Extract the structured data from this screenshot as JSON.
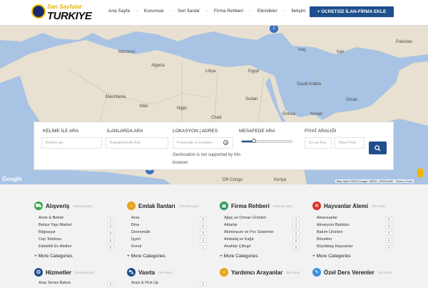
{
  "header": {
    "logo_top": "Sarı Sayfalar",
    "logo_main": "TURKIYE",
    "nav": [
      "Ana Sayfa",
      "Kurumsal",
      "Seri İlanlar",
      "Firma Rehberi",
      "Etkinlikler",
      "İletişim"
    ],
    "cta": "+ ÜCRETSİZ İLAN-FİRMA EKLE",
    "cta_color": "#1f4e8c"
  },
  "map": {
    "labels": [
      "Morocco",
      "Algeria",
      "Libya",
      "Egypt",
      "Iraq",
      "Iran",
      "Saudi Arabia",
      "Mauritania",
      "Mali",
      "Niger",
      "Chad",
      "Sudan",
      "Eritrea",
      "Yemen",
      "Oman",
      "DR Congo",
      "Kenya",
      "Pakistan"
    ],
    "cluster_top": "2",
    "cluster_bottom": "2",
    "attribution": "Map data ©2015 Google, INEGI, ORION-ME",
    "terms": "Terms of Use",
    "google": "Google"
  },
  "search": {
    "keyword_label": "KELİME İLE ARA",
    "keyword_placeholder": "Kelime gir",
    "category_label": "İLANLARDA ARA",
    "category_placeholder": "Kategorilerde Ara",
    "location_label": "LOKASYON | ADRES",
    "location_placeholder": "Postcode or location",
    "geo_note": "Geolocation is not supported by this browser.",
    "distance_label": "MESAFEDE ARA",
    "price_label": "FİYAT ARALIĞI",
    "price_min_placeholder": "En az fiya",
    "price_max_placeholder": "Max Price"
  },
  "categories": [
    {
      "title": "Alışveriş",
      "sub": "(Tümünü gör)",
      "color": "#3aa54a",
      "icon": "shopping-icon",
      "items": [
        {
          "name": "Anne & Bebek",
          "count": "1"
        },
        {
          "name": "Bahçe Yapı Market",
          "count": "0"
        },
        {
          "name": "Bilgisayar",
          "count": "0"
        },
        {
          "name": "Cep Telefonu",
          "count": "0"
        },
        {
          "name": "Elektrikli Ev Aletleri",
          "count": "0"
        }
      ],
      "more": "+ More Categories"
    },
    {
      "title": "Emlak İlanları",
      "sub": "(Tümünü gör)",
      "color": "#e8a317",
      "icon": "home-icon",
      "items": [
        {
          "name": "Arsa",
          "count": "0"
        },
        {
          "name": "Bina",
          "count": "0"
        },
        {
          "name": "Devremülk",
          "count": "0"
        },
        {
          "name": "İşyeri",
          "count": "0"
        },
        {
          "name": "Konut",
          "count": "1"
        }
      ],
      "more": "+ More Categories"
    },
    {
      "title": "Firma Rehberi",
      "sub": "(Tümünü gör)",
      "color": "#2e9a5a",
      "icon": "briefcase-icon",
      "items": [
        {
          "name": "Ağaç ve Orman Ürünleri",
          "count": "3"
        },
        {
          "name": "Aktarlar",
          "count": "0"
        },
        {
          "name": "Alüminyum ve Pvc Sistemler",
          "count": "0"
        },
        {
          "name": "Ambalaj ve Kağıt",
          "count": "0"
        },
        {
          "name": "Anahtar Çilingir",
          "count": "0"
        }
      ],
      "more": "+ More Categories"
    },
    {
      "title": "Hayvanlar Alemi",
      "sub": "(No Post)",
      "color": "#d9342b",
      "icon": "paw-icon",
      "items": [
        {
          "name": "Aksesuarlar",
          "count": "0"
        },
        {
          "name": "Akvaryum Balıkları",
          "count": "0"
        },
        {
          "name": "Bakım Ürünleri",
          "count": "0"
        },
        {
          "name": "Böcekler",
          "count": "0"
        },
        {
          "name": "Büyükbaş Hayvanlar",
          "count": "0"
        }
      ],
      "more": "+ More Categories"
    }
  ],
  "categories2": [
    {
      "title": "Hizmetler",
      "sub": "(Tümünü gör)",
      "color": "#1f4e8c",
      "icon": "medal-icon",
      "first": "Araç Servis Bakım",
      "count": "0"
    },
    {
      "title": "Vasıta",
      "sub": "(No Post)",
      "color": "#1f4e8c",
      "icon": "car-icon",
      "first": "Arazi & Pick Up",
      "count": "0"
    },
    {
      "title": "Yardımcı Arayanlar",
      "sub": "(No Post)",
      "color": "#e8a317",
      "icon": "person-icon",
      "first": "",
      "count": ""
    },
    {
      "title": "Özel Ders Verenler",
      "sub": "(No Post)",
      "color": "#3b8fd9",
      "icon": "teacher-icon",
      "first": "",
      "count": ""
    }
  ]
}
